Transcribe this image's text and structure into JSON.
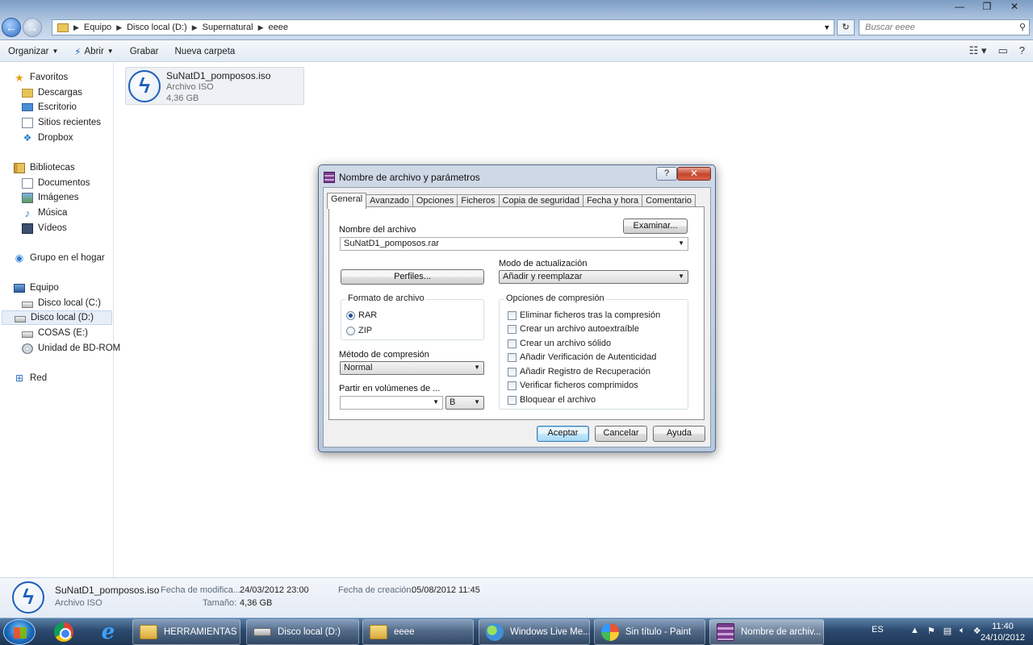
{
  "window": {
    "minimize": "—",
    "maximize": "❐",
    "close": "✕"
  },
  "address": {
    "crumbs": [
      "Equipo",
      "Disco local (D:)",
      "Supernatural",
      "eeee"
    ],
    "search_placeholder": "Buscar eeee"
  },
  "toolbar": {
    "organize": "Organizar",
    "open": "Abrir",
    "burn": "Grabar",
    "new_folder": "Nueva carpeta"
  },
  "sidebar": {
    "favorites": "Favoritos",
    "downloads": "Descargas",
    "desktop": "Escritorio",
    "recent": "Sitios recientes",
    "dropbox": "Dropbox",
    "libraries": "Bibliotecas",
    "documents": "Documentos",
    "images": "Imágenes",
    "music": "Música",
    "videos": "Vídeos",
    "homegroup": "Grupo en el hogar",
    "computer": "Equipo",
    "drive_c": "Disco local (C:)",
    "drive_d": "Disco local (D:)",
    "drive_e": "COSAS (E:)",
    "bdrom": "Unidad de BD-ROM",
    "network": "Red"
  },
  "file": {
    "name": "SuNatD1_pomposos.iso",
    "type": "Archivo ISO",
    "size": "4,36 GB"
  },
  "details": {
    "name": "SuNatD1_pomposos.iso",
    "type": "Archivo ISO",
    "modified_label": "Fecha de modifica...",
    "modified_value": "24/03/2012 23:00",
    "size_label": "Tamaño:",
    "size_value": "4,36 GB",
    "created_label": "Fecha de creación:",
    "created_value": "05/08/2012 11:45"
  },
  "dialog": {
    "title": "Nombre de archivo y parámetros",
    "help": "?",
    "close": "✕",
    "tabs": [
      "General",
      "Avanzado",
      "Opciones",
      "Ficheros",
      "Copia de seguridad",
      "Fecha y hora",
      "Comentario"
    ],
    "filename_label": "Nombre del archivo",
    "browse": "Examinar...",
    "filename_value": "SuNatD1_pomposos.rar",
    "profiles": "Perfiles...",
    "update_mode_label": "Modo de actualización",
    "update_mode_value": "Añadir y reemplazar",
    "format_title": "Formato de archivo",
    "format_rar": "RAR",
    "format_zip": "ZIP",
    "method_label": "Método de compresión",
    "method_value": "Normal",
    "split_label": "Partir en volúmenes de ...",
    "split_value": "",
    "split_unit": "B",
    "options_title": "Opciones de compresión",
    "options": [
      "Eliminar ficheros tras la compresión",
      "Crear un archivo autoextraíble",
      "Crear un archivo sólido",
      "Añadir Verificación de Autenticidad",
      "Añadir Registro de Recuperación",
      "Verificar ficheros comprimidos",
      "Bloquear el archivo"
    ],
    "ok": "Aceptar",
    "cancel": "Cancelar",
    "help_button": "Ayuda"
  },
  "taskbar": {
    "tasks": [
      "HERRAMIENTAS ...",
      "Disco local (D:)",
      "eeee",
      "Windows Live Me...",
      "Sin título - Paint",
      "Nombre de archiv..."
    ],
    "lang": "ES",
    "time": "11:40",
    "date": "24/10/2012"
  },
  "colors": {
    "accent": "#1d5fb8",
    "taskbar": "#2c4a6f",
    "close_red": "#c5452b"
  }
}
